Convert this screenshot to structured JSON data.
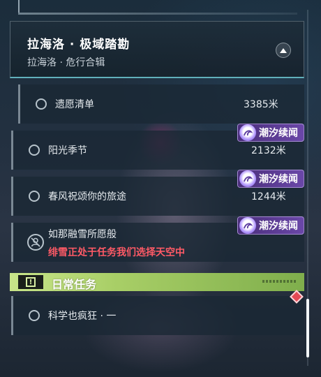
{
  "header": {
    "title": "拉海洛 · 极域踏勘",
    "subtitle": "拉海洛 · 危行合辑"
  },
  "quests": [
    {
      "name": "遗愿清单",
      "distance": "3385米",
      "tag": ""
    },
    {
      "name": "阳光季节",
      "distance": "2132米",
      "tag": "潮汐续闻"
    },
    {
      "name": "春风祝颂你的旅途",
      "distance": "1244米",
      "tag": "潮汐续闻"
    },
    {
      "name": "如那融雪所愿般",
      "distance": "",
      "tag": "潮汐续闻",
      "warning": "绯雪正处于任务我们选择天空中"
    }
  ],
  "daily": {
    "title": "日常任务",
    "items": [
      {
        "name": "科学也疯狂 · 一"
      }
    ]
  },
  "colors": {
    "accent_cyan": "#78dce6",
    "tag_purple": "#6a47a8",
    "warning_red": "#ff5a66",
    "daily_green": "#a9cf67",
    "tracked_marker": "#e54a55"
  },
  "icons": {
    "collapse": "chevron-up-icon",
    "quest_status": "circle-icon",
    "tag": "tide-swirl-icon",
    "locked_character": "person-slash-icon",
    "daily": "exclamation-box-icon",
    "tracked": "diamond-marker-icon"
  }
}
